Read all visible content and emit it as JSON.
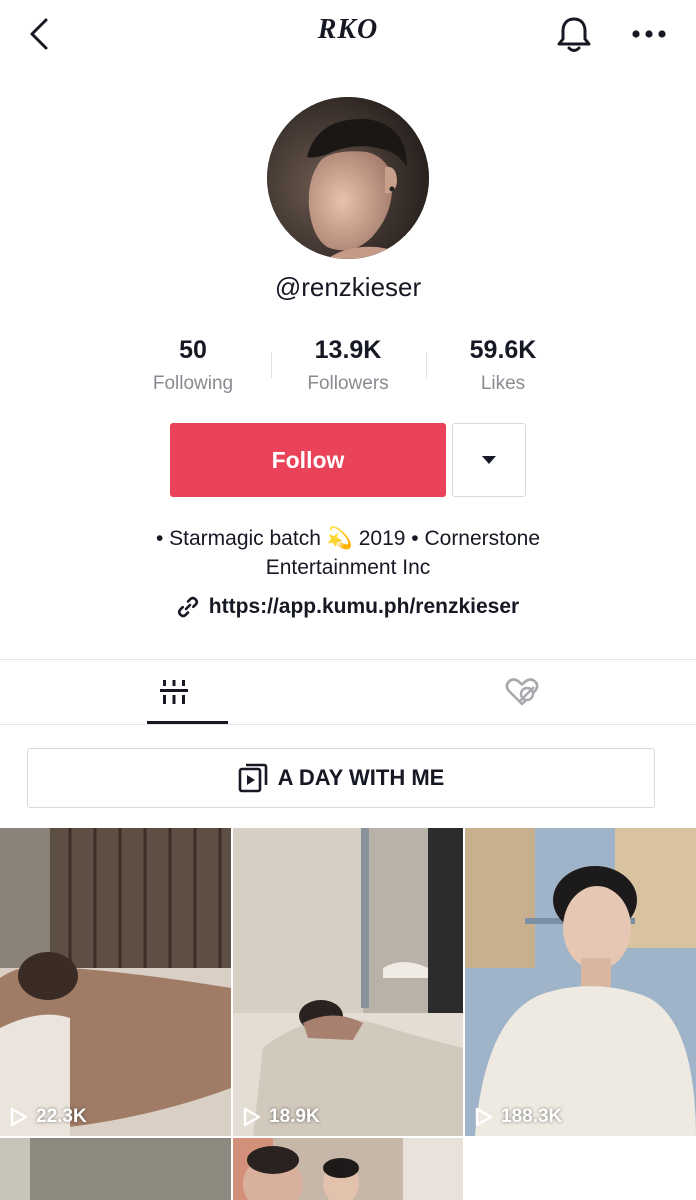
{
  "header": {
    "title": "RKO",
    "back_icon": "chevron-left-icon",
    "bell_icon": "bell-icon",
    "more_icon": "more-horizontal-icon"
  },
  "profile": {
    "username": "@renzkieser",
    "stats": [
      {
        "value": "50",
        "label": "Following"
      },
      {
        "value": "13.9K",
        "label": "Followers"
      },
      {
        "value": "59.6K",
        "label": "Likes"
      }
    ],
    "follow_label": "Follow",
    "bio_line1_a": "• Starmagic batch",
    "bio_emoji": "💫",
    "bio_line1_b": "2019 • Cornerstone",
    "bio_line2": "Entertainment Inc",
    "link": "https://app.kumu.ph/renzkieser"
  },
  "tabs": {
    "videos_icon": "grid-icon",
    "liked_icon": "hidden-heart-icon",
    "active": "videos"
  },
  "playlist": {
    "label": "A DAY WITH ME"
  },
  "videos": [
    {
      "views": "22.3K"
    },
    {
      "views": "18.9K"
    },
    {
      "views": "188.3K"
    },
    {
      "views": ""
    },
    {
      "views": ""
    }
  ],
  "colors": {
    "accent": "#ea4359",
    "text": "#161823",
    "secondary_text": "#8a8b91"
  }
}
